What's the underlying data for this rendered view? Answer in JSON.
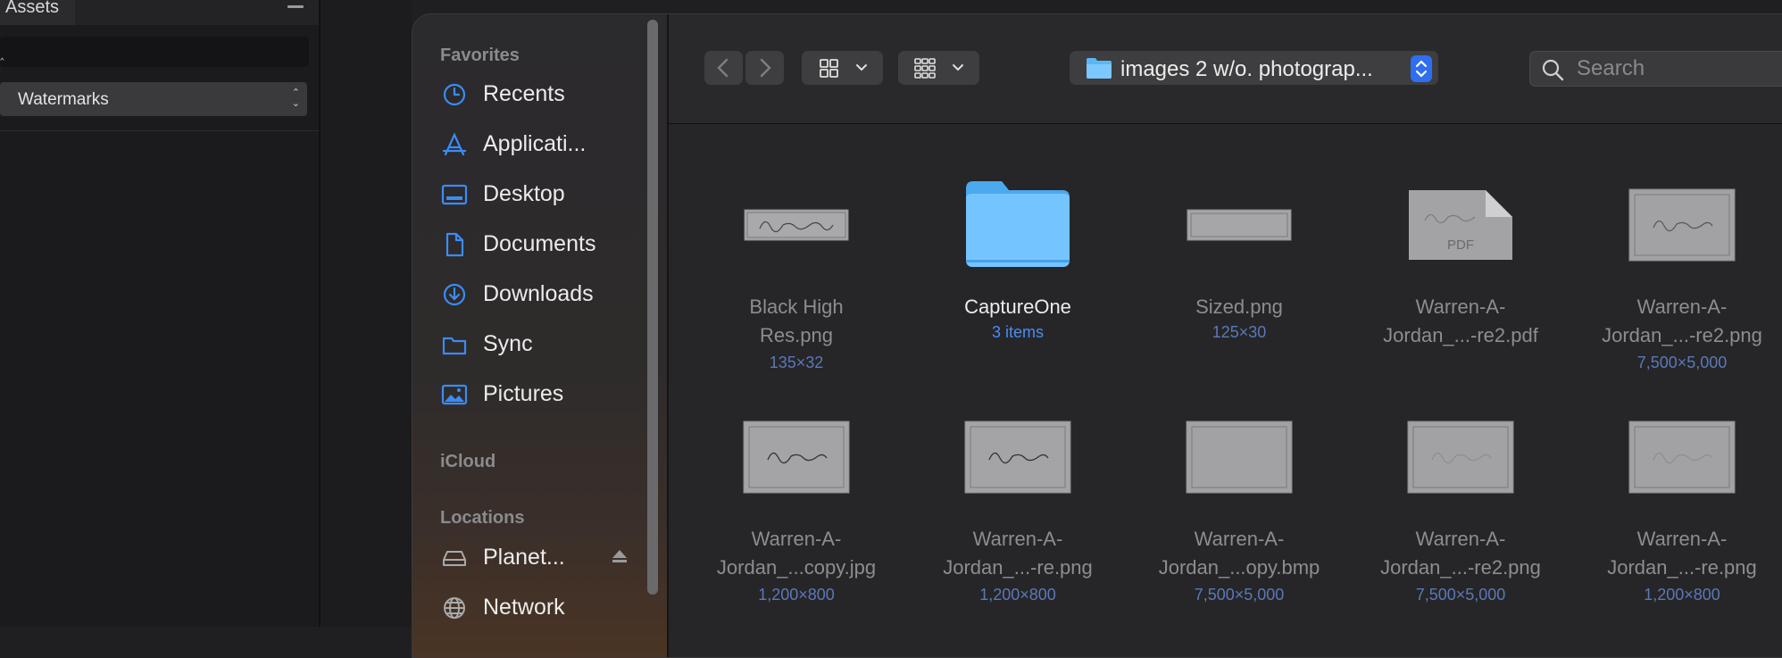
{
  "assets_panel": {
    "tab_label": "Assets",
    "category_select": "Watermarks"
  },
  "sidebar": {
    "sections": {
      "favorites": "Favorites",
      "icloud": "iCloud",
      "locations": "Locations"
    },
    "favorites": [
      {
        "label": "Recents",
        "icon": "clock-icon"
      },
      {
        "label": "Applicati...",
        "icon": "applications-icon"
      },
      {
        "label": "Desktop",
        "icon": "desktop-icon"
      },
      {
        "label": "Documents",
        "icon": "document-icon"
      },
      {
        "label": "Downloads",
        "icon": "download-icon"
      },
      {
        "label": "Sync",
        "icon": "folder-icon"
      },
      {
        "label": "Pictures",
        "icon": "pictures-icon"
      }
    ],
    "locations": [
      {
        "label": "Planet...",
        "icon": "drive-icon"
      },
      {
        "label": "Network",
        "icon": "network-icon"
      }
    ]
  },
  "toolbar": {
    "path_label": "images 2 w/o. photograp...",
    "search_placeholder": "Search"
  },
  "accent_color": "#2f6ef0",
  "folder_color": "#6cc4ff",
  "files": [
    {
      "name_line1": "Black High",
      "name_line2": "Res.png",
      "meta": "135×32",
      "kind": "strip"
    },
    {
      "name_line1": "CaptureOne",
      "name_line2": "",
      "meta": "3 items",
      "kind": "folder"
    },
    {
      "name_line1": "Sized.png",
      "name_line2": "",
      "meta": "125×30",
      "kind": "blank-strip"
    },
    {
      "name_line1": "Warren-A-",
      "name_line2": "Jordan_...-re2.pdf",
      "meta": "",
      "kind": "pdf"
    },
    {
      "name_line1": "Warren-A-",
      "name_line2": "Jordan_...-re2.png",
      "meta": "7,500×5,000",
      "kind": "card"
    },
    {
      "name_line1": "Warren-A-",
      "name_line2": "Jordan_...copy.jpg",
      "meta": "1,200×800",
      "kind": "card"
    },
    {
      "name_line1": "Warren-A-",
      "name_line2": "Jordan_...-re.png",
      "meta": "1,200×800",
      "kind": "card"
    },
    {
      "name_line1": "Warren-A-",
      "name_line2": "Jordan_...opy.bmp",
      "meta": "7,500×5,000",
      "kind": "blank-card"
    },
    {
      "name_line1": "Warren-A-",
      "name_line2": "Jordan_...-re2.png",
      "meta": "7,500×5,000",
      "kind": "faint-card"
    },
    {
      "name_line1": "Warren-A-",
      "name_line2": "Jordan_...-re.png",
      "meta": "1,200×800",
      "kind": "faint-card"
    }
  ],
  "pdf_badge": "PDF"
}
